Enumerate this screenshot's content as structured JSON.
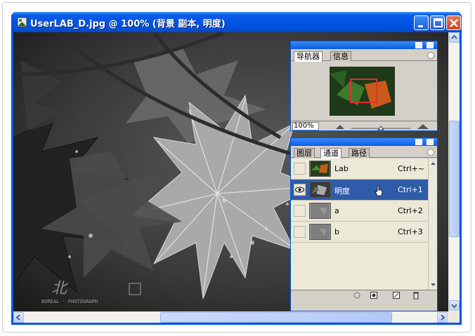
{
  "window": {
    "title": "UserLAB_D.jpg @ 100% (背景 副本, 明度)"
  },
  "navigator": {
    "tabs": [
      "导航器",
      "信息"
    ],
    "zoom": "100%"
  },
  "channels": {
    "tabs": [
      "图层",
      "通道",
      "路径"
    ],
    "rows": [
      {
        "name": "Lab",
        "shortcut": "Ctrl+~",
        "visible": false,
        "selected": false
      },
      {
        "name": "明度",
        "shortcut": "Ctrl+1",
        "visible": true,
        "selected": true
      },
      {
        "name": "a",
        "shortcut": "Ctrl+2",
        "visible": false,
        "selected": false
      },
      {
        "name": "b",
        "shortcut": "Ctrl+3",
        "visible": false,
        "selected": false
      }
    ]
  },
  "watermark": {
    "text": "BOREAL · PHOTOGRAPH"
  },
  "colors": {
    "titlebar": "#0054e3",
    "selection": "#2f5ca8",
    "palette_bg": "#d4d0c8"
  }
}
